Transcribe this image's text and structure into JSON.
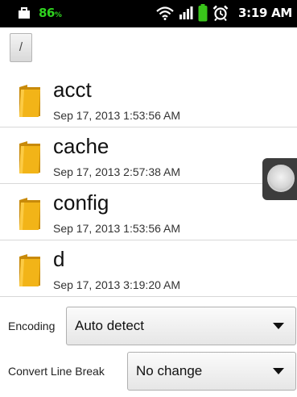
{
  "status_bar": {
    "battery_percent": "86",
    "battery_unit": "%",
    "time": "3:19 AM",
    "icons": [
      "briefcase-icon",
      "wifi-icon",
      "signal-icon",
      "battery-icon",
      "alarm-icon"
    ],
    "colors": {
      "background": "#000000",
      "battery_text": "#2fd31f",
      "battery_fill": "#39c41a"
    }
  },
  "breadcrumb": {
    "path_label": "/"
  },
  "files": [
    {
      "name": "acct",
      "date": "Sep 17, 2013 1:53:56 AM",
      "icon": "folder-icon"
    },
    {
      "name": "cache",
      "date": "Sep 17, 2013 2:57:38 AM",
      "icon": "folder-icon"
    },
    {
      "name": "config",
      "date": "Sep 17, 2013 1:53:56 AM",
      "icon": "folder-icon"
    },
    {
      "name": "d",
      "date": "Sep 17, 2013 3:19:20 AM",
      "icon": "folder-icon"
    }
  ],
  "encoding": {
    "label": "Encoding",
    "value": "Auto detect"
  },
  "line_break": {
    "label": "Convert Line Break",
    "value": "No change"
  },
  "colors": {
    "folder": "#f2b418",
    "divider": "#d8d8d8"
  }
}
